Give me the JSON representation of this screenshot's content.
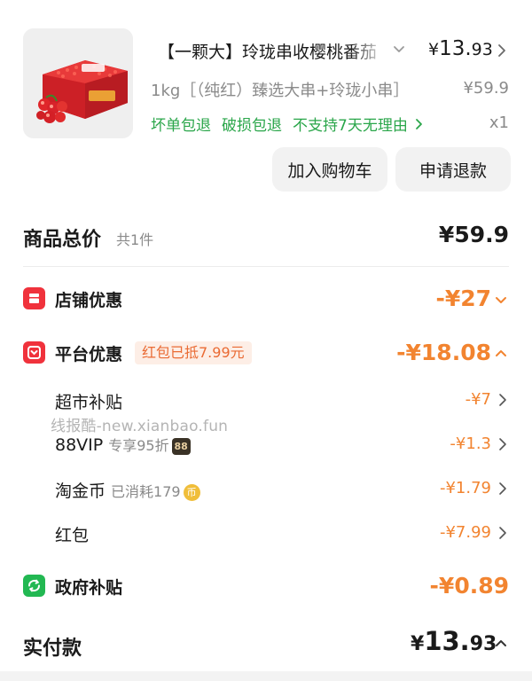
{
  "product": {
    "title": "【一颗大】玲珑串收樱桃番茄",
    "price_symbol": "¥",
    "price_int": "13.",
    "price_dec": "93",
    "spec": "1kg［（纯红）臻选大串+玲珑小串］",
    "original_price": "¥59.9",
    "tags": [
      "坏单包退",
      "破损包退",
      "不支持7天无理由"
    ],
    "quantity": "x1",
    "image_icon": "tomato-gift-box-image",
    "buttons": {
      "add_to_cart": "加入购物车",
      "refund": "申请退款"
    }
  },
  "summary": {
    "label": "商品总价",
    "count": "共1件",
    "total": "¥59.9"
  },
  "discounts": {
    "store": {
      "label": "店铺优惠",
      "amount": "-¥27",
      "icon": "store-icon"
    },
    "platform": {
      "label": "平台优惠",
      "tag": "红包已抵7.99元",
      "amount": "-¥18.08",
      "icon": "platform-gift-icon"
    },
    "items": [
      {
        "label": "超市补贴",
        "note": "",
        "amount": "-¥7"
      },
      {
        "label": "88VIP",
        "note": "专享95折",
        "badge": "88",
        "amount": "-¥1.3"
      },
      {
        "label": "淘金币",
        "note": "已消耗179",
        "badge": "币",
        "amount": "-¥1.79"
      },
      {
        "label": "红包",
        "note": "",
        "amount": "-¥7.99"
      }
    ],
    "government": {
      "label": "政府补贴",
      "amount": "-¥0.89",
      "icon": "government-subsidy-icon"
    }
  },
  "watermark": "线报酷-new.xianbao.fun",
  "payment": {
    "label": "实付款",
    "price_symbol": "¥",
    "price_int": "13.",
    "price_dec": "93"
  },
  "colors": {
    "accent_orange": "#f28430",
    "green": "#2aa64a",
    "red_icon": "#f0323c",
    "green_icon": "#22b852"
  }
}
